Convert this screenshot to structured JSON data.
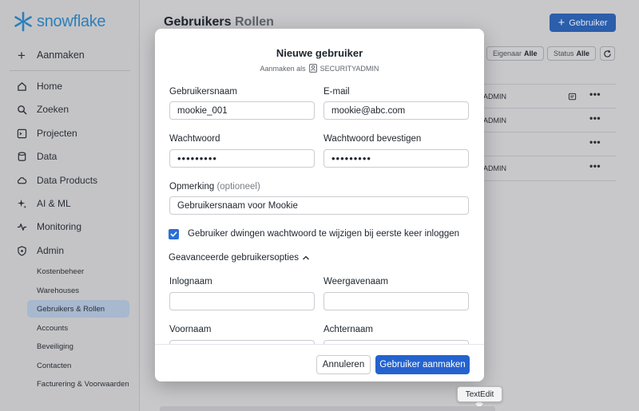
{
  "sidebar": {
    "logo_text": "snowflake",
    "create_label": "Aanmaken",
    "items": [
      {
        "label": "Home",
        "icon": "home-icon"
      },
      {
        "label": "Zoeken",
        "icon": "search-icon"
      },
      {
        "label": "Projecten",
        "icon": "projects-icon"
      },
      {
        "label": "Data",
        "icon": "database-icon"
      },
      {
        "label": "Data Products",
        "icon": "cloud-icon"
      },
      {
        "label": "AI & ML",
        "icon": "sparkle-icon"
      },
      {
        "label": "Monitoring",
        "icon": "activity-icon"
      },
      {
        "label": "Admin",
        "icon": "shield-icon"
      }
    ],
    "admin_subitems": [
      {
        "label": "Kostenbeheer"
      },
      {
        "label": "Warehouses"
      },
      {
        "label": "Gebruikers & Rollen",
        "active": true
      },
      {
        "label": "Accounts"
      },
      {
        "label": "Beveiliging"
      },
      {
        "label": "Contacten"
      },
      {
        "label": "Facturering & Voorwaarden"
      }
    ]
  },
  "main": {
    "tabs": [
      {
        "label": "Gebruikers",
        "active": true
      },
      {
        "label": "Rollen",
        "active": false
      }
    ],
    "new_user_label": "Gebruiker",
    "filters": [
      {
        "name": "Eigenaar",
        "value": "Alle"
      },
      {
        "name": "Status",
        "value": "Alle"
      }
    ],
    "rows": [
      {
        "text": "ADMIN"
      },
      {
        "text": "ADMIN"
      },
      {
        "text": ""
      },
      {
        "text": "ADMIN"
      }
    ]
  },
  "modal": {
    "title": "Nieuwe gebruiker",
    "subtitle_prefix": "Aanmaken als",
    "subtitle_role": "SECURITYADMIN",
    "username_label": "Gebruikersnaam",
    "username_value": "mookie_001",
    "email_label": "E-mail",
    "email_value": "mookie@abc.com",
    "password_label": "Wachtwoord",
    "password_value": "•••••••••",
    "confirm_label": "Wachtwoord bevestigen",
    "confirm_value": "•••••••••",
    "comment_label": "Opmerking",
    "comment_optional": "(optioneel)",
    "comment_value": "Gebruikersnaam voor Mookie",
    "force_pw_label": "Gebruiker dwingen wachtwoord te wijzigen bij eerste keer inloggen",
    "force_pw_checked": true,
    "advanced_label": "Geavanceerde gebruikersopties",
    "login_label": "Inlognaam",
    "display_label": "Weergavenaam",
    "first_label": "Voornaam",
    "last_label": "Achternaam",
    "cancel_label": "Annuleren",
    "create_label": "Gebruiker aanmaken"
  },
  "tooltip": {
    "text": "TextEdit"
  },
  "colors": {
    "accent": "#2463cf",
    "brand": "#2d7fb8",
    "sidebar_active": "#a7b8cf"
  }
}
